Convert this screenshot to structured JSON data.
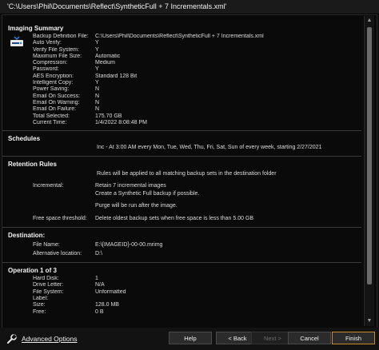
{
  "window": {
    "title": "'C:\\Users\\Phil\\Documents\\Reflect\\SyntheticFull + 7 Incrementals.xml'"
  },
  "imaging": {
    "title": "Imaging Summary",
    "rows": [
      {
        "k": "Backup Definition File:",
        "v": "C:\\Users\\Phil\\Documents\\Reflect\\SyntheticFull + 7 Incrementals.xml"
      },
      {
        "k": "Auto Verify:",
        "v": "Y"
      },
      {
        "k": "Verify File System:",
        "v": "Y"
      },
      {
        "k": "Maximum File Size:",
        "v": "Automatic"
      },
      {
        "k": "Compression:",
        "v": "Medium"
      },
      {
        "k": "Password:",
        "v": "Y"
      },
      {
        "k": "AES Encryption:",
        "v": "Standard 128 Bit"
      },
      {
        "k": "Intelligent Copy:",
        "v": "Y"
      },
      {
        "k": "Power Saving:",
        "v": "N"
      },
      {
        "k": "Email On Success:",
        "v": "N"
      },
      {
        "k": "Email On Warning:",
        "v": "N"
      },
      {
        "k": "Email On Failure:",
        "v": "N"
      },
      {
        "k": "Total Selected:",
        "v": "175.70 GB"
      },
      {
        "k": "Current Time:",
        "v": "1/4/2022 8:08:48 PM"
      }
    ]
  },
  "schedules": {
    "title": "Schedules",
    "line": "Inc - At 3:00 AM every Mon, Tue, Wed, Thu, Fri, Sat, Sun of every week, starting 2/27/2021"
  },
  "retention": {
    "title": "Retention Rules",
    "intro": "Rules will be applied to all matching backup sets in the destination folder",
    "incremental_label": "Incremental:",
    "incremental_line1": "Retain 7 incremental images",
    "incremental_line2": "Create a Synthetic Full backup if possible.",
    "purge": "Purge will be run after the image.",
    "free_label": "Free space threshold:",
    "free_value": "Delete oldest backup sets when free space is less than 5.00 GB"
  },
  "destination": {
    "title": "Destination:",
    "file_label": "File Name:",
    "file_value": "E:\\{IMAGEID}-00-00.mrimg",
    "alt_label": "Alternative location:",
    "alt_value": "D:\\"
  },
  "operation": {
    "title": "Operation 1 of 3",
    "rows": [
      {
        "k": "Hard Disk:",
        "v": "1"
      },
      {
        "k": "Drive Letter:",
        "v": "N/A"
      },
      {
        "k": "File System:",
        "v": "Unformatted"
      },
      {
        "k": "Label:",
        "v": ""
      },
      {
        "k": "Size:",
        "v": "128.0 MB"
      },
      {
        "k": "Free:",
        "v": "0 B"
      }
    ]
  },
  "footer": {
    "advanced_options": "Advanced Options",
    "help": "Help",
    "back": "< Back",
    "next": "Next >",
    "cancel": "Cancel",
    "finish": "Finish"
  },
  "colors": {
    "accent": "#c9892b",
    "background": "#0e0e0e"
  }
}
